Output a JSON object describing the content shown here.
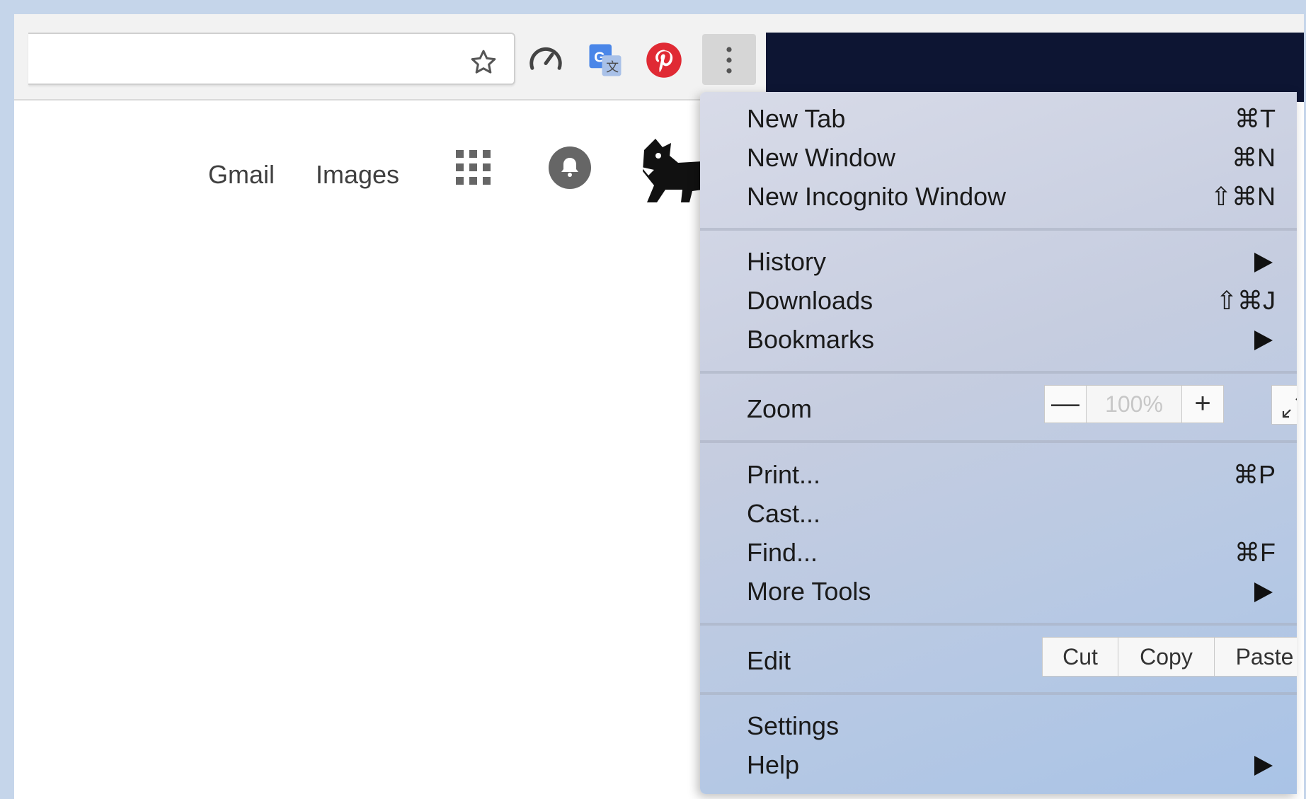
{
  "google_bar": {
    "gmail": "Gmail",
    "images": "Images"
  },
  "menu": {
    "group1": [
      {
        "label": "New Tab",
        "shortcut": "⌘T"
      },
      {
        "label": "New Window",
        "shortcut": "⌘N"
      },
      {
        "label": "New Incognito Window",
        "shortcut": "⇧⌘N"
      }
    ],
    "group2": [
      {
        "label": "History",
        "shortcut": ""
      },
      {
        "label": "Downloads",
        "shortcut": "⇧⌘J"
      },
      {
        "label": "Bookmarks",
        "shortcut": ""
      }
    ],
    "zoom": {
      "label": "Zoom",
      "minus": "—",
      "value": "100%",
      "plus": "+"
    },
    "group4": [
      {
        "label": "Print...",
        "shortcut": "⌘P"
      },
      {
        "label": "Cast...",
        "shortcut": ""
      },
      {
        "label": "Find...",
        "shortcut": "⌘F"
      },
      {
        "label": "More Tools",
        "shortcut": ""
      }
    ],
    "edit": {
      "label": "Edit",
      "cut": "Cut",
      "copy": "Copy",
      "paste": "Paste"
    },
    "group6": [
      {
        "label": "Settings",
        "shortcut": ""
      },
      {
        "label": "Help",
        "shortcut": ""
      }
    ]
  },
  "icons": {
    "bookmark": "star-icon",
    "extensions": [
      "speedometer-icon",
      "google-translate-icon",
      "pinterest-icon"
    ],
    "menu": "three-dots-vertical-icon",
    "apps": "apps-grid-icon",
    "notifications": "bell-icon",
    "avatar": "dog-avatar-icon"
  },
  "colors": {
    "pinterest": "#e02a34",
    "translate": "#4a86e8",
    "theme": "#0d1533"
  }
}
